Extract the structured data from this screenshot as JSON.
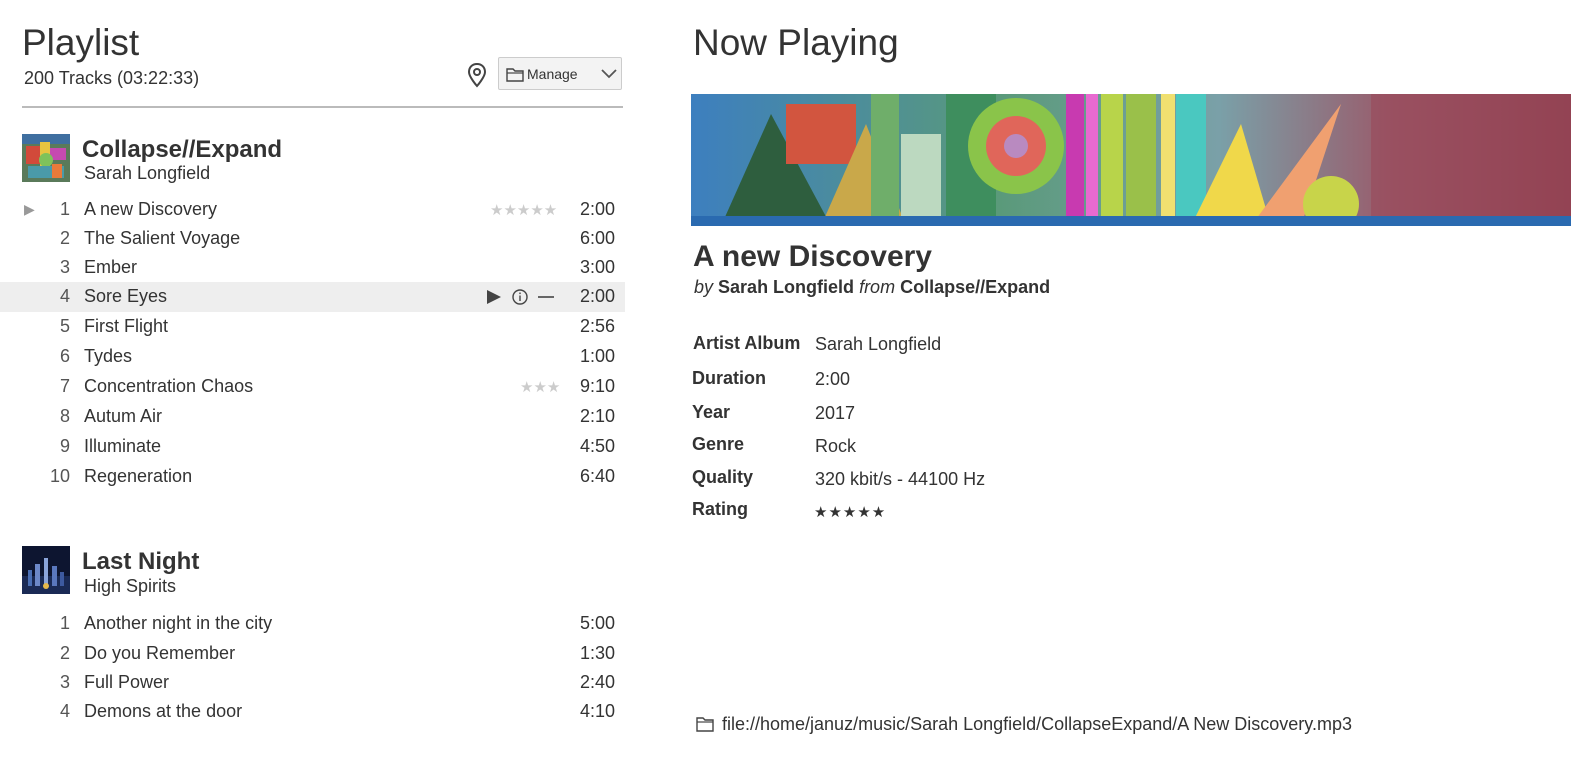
{
  "playlist": {
    "title": "Playlist",
    "summary": "200 Tracks (03:22:33)",
    "manage_label": "Manage",
    "albums": [
      {
        "title": "Collapse//Expand",
        "artist": "Sarah Longfield",
        "tracks": [
          {
            "num": "1",
            "name": "A new Discovery",
            "duration": "2:00",
            "rating_stars": "★★★★★",
            "playing": true
          },
          {
            "num": "2",
            "name": "The Salient Voyage",
            "duration": "6:00"
          },
          {
            "num": "3",
            "name": "Ember",
            "duration": "3:00"
          },
          {
            "num": "4",
            "name": "Sore Eyes",
            "duration": "2:00",
            "hover": true
          },
          {
            "num": "5",
            "name": "First Flight",
            "duration": "2:56"
          },
          {
            "num": "6",
            "name": "Tydes",
            "duration": "1:00"
          },
          {
            "num": "7",
            "name": "Concentration Chaos",
            "duration": "9:10",
            "rating_stars": "★★★"
          },
          {
            "num": "8",
            "name": "Autum Air",
            "duration": "2:10"
          },
          {
            "num": "9",
            "name": "Illuminate",
            "duration": "4:50"
          },
          {
            "num": "10",
            "name": "Regeneration",
            "duration": "6:40"
          }
        ]
      },
      {
        "title": "Last Night",
        "artist": "High Spirits",
        "tracks": [
          {
            "num": "1",
            "name": "Another night in the city",
            "duration": "5:00"
          },
          {
            "num": "2",
            "name": "Do you Remember",
            "duration": "1:30"
          },
          {
            "num": "3",
            "name": "Full Power",
            "duration": "2:40"
          },
          {
            "num": "4",
            "name": "Demons at the door",
            "duration": "4:10"
          }
        ]
      }
    ]
  },
  "now_playing": {
    "heading": "Now Playing",
    "song_title": "A new Discovery",
    "by_word": "by",
    "artist": "Sarah Longfield",
    "from_word": "from",
    "album": "Collapse//Expand",
    "details": [
      {
        "label": "Artist Album",
        "value": "Sarah Longfield"
      },
      {
        "label": "Duration",
        "value": "2:00"
      },
      {
        "label": "Year",
        "value": "2017"
      },
      {
        "label": "Genre",
        "value": "Rock"
      },
      {
        "label": "Quality",
        "value": "320 kbit/s - 44100 Hz"
      },
      {
        "label": "Rating",
        "value": "★★★★★"
      }
    ],
    "rating_value": 5,
    "file_path": "file://home/januz/music/Sarah Longfield/CollapseExpand/A New Discovery.mp3"
  },
  "icons": {
    "location": "location-pin-icon",
    "folder": "folder-icon",
    "chevron": "chevron-down-icon",
    "play": "play-icon",
    "info": "info-icon",
    "remove": "minus-icon"
  },
  "colors": {
    "hover_row": "#eeeeee",
    "star_inactive": "#cccccc",
    "star_active": "#333333"
  }
}
